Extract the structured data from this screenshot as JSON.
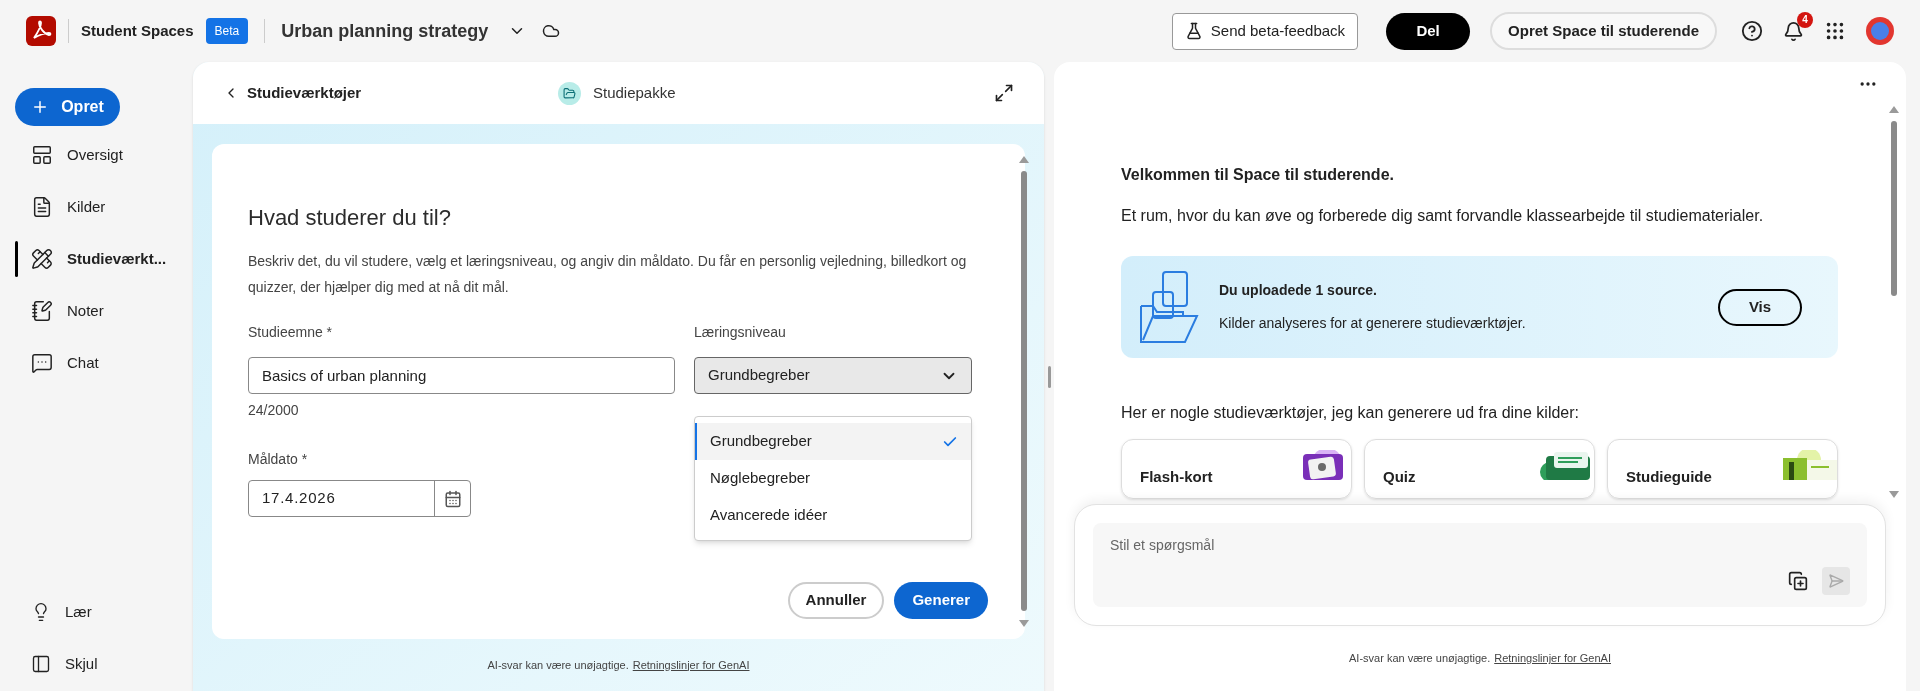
{
  "app": {
    "name": "Student Spaces",
    "badge": "Beta",
    "document_title": "Urban planning strategy"
  },
  "header_actions": {
    "feedback": "Send beta-feedback",
    "share": "Del",
    "create_space": "Opret Space til studerende",
    "notification_count": "4"
  },
  "sidebar": {
    "create_button": "Opret",
    "items": [
      {
        "label": "Oversigt",
        "selected": false
      },
      {
        "label": "Kilder",
        "selected": false
      },
      {
        "label": "Studieværkt...",
        "selected": true
      },
      {
        "label": "Noter",
        "selected": false
      },
      {
        "label": "Chat",
        "selected": false
      }
    ],
    "bottom_items": [
      {
        "label": "Lær"
      },
      {
        "label": "Skjul"
      }
    ]
  },
  "left_panel": {
    "back_label": "Studieværktøjer",
    "package_label": "Studiepakke",
    "form": {
      "title": "Hvad studerer du til?",
      "description": "Beskriv det, du vil studere, vælg et læringsniveau, og angiv din måldato. Du får en personlig vejledning, billedkort og quizzer, der hjælper dig med at nå dit mål.",
      "topic": {
        "label": "Studieemne *",
        "value": "Basics of urban planning",
        "counter": "24/2000"
      },
      "level": {
        "label": "Læringsniveau",
        "value": "Grundbegreber",
        "expanded": true,
        "options": [
          {
            "label": "Grundbegreber",
            "selected": true
          },
          {
            "label": "Nøglebegreber",
            "selected": false
          },
          {
            "label": "Avancerede idéer",
            "selected": false
          }
        ]
      },
      "date": {
        "label": "Måldato *",
        "value": "17.4.2026"
      },
      "buttons": {
        "cancel": "Annuller",
        "submit": "Generer"
      }
    },
    "footer": {
      "text": "AI-svar kan være unøjagtige.",
      "link": "Retningslinjer for GenAI"
    }
  },
  "right_panel": {
    "welcome_title": "Velkommen til Space til studerende.",
    "welcome_text": "Et rum, hvor du kan øve og forberede dig samt forvandle klassearbejde til studiematerialer.",
    "upload_banner": {
      "title": "Du uploadede 1 source.",
      "text": "Kilder analyseres for at generere studieværktøjer.",
      "button": "Vis"
    },
    "tools_heading": "Her er nogle studieværktøjer, jeg kan generere ud fra dine kilder:",
    "tools": [
      {
        "label": "Flash-kort",
        "kind": "flashcards"
      },
      {
        "label": "Quiz",
        "kind": "quiz"
      },
      {
        "label": "Studieguide",
        "kind": "guide"
      }
    ],
    "chat": {
      "placeholder": "Stil et spørgsmål"
    },
    "footer": {
      "text": "AI-svar kan være unøjagtige.",
      "link": "Retningslinjer for GenAI"
    }
  }
}
